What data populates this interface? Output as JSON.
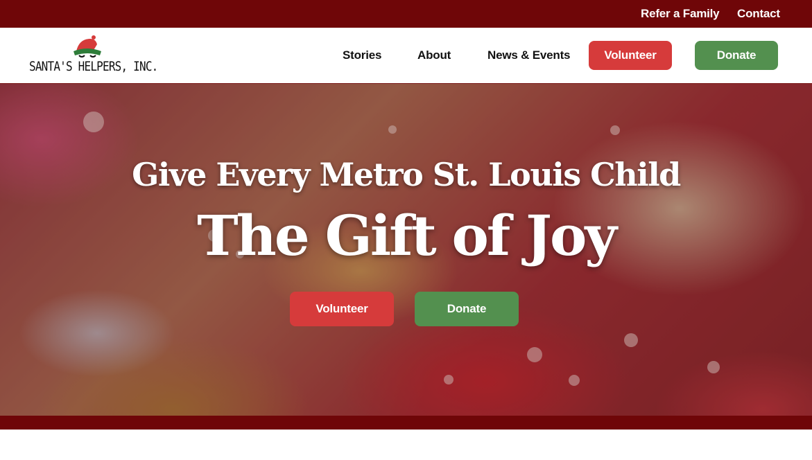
{
  "topbar": {
    "links": [
      "Refer a Family",
      "Contact"
    ]
  },
  "header": {
    "logo_text": "SANTA'S HELPERS, INC.",
    "nav": [
      "Stories",
      "About",
      "News & Events"
    ],
    "volunteer_label": "Volunteer",
    "donate_label": "Donate"
  },
  "hero": {
    "line1": "Give Every Metro St. Louis Child",
    "line2": "The Gift of Joy",
    "volunteer_label": "Volunteer",
    "donate_label": "Donate"
  },
  "colors": {
    "dark_red": "#6f0608",
    "button_red": "#d63b3b",
    "button_green": "#53904f"
  },
  "icons": {
    "logo": "elf-hat-icon"
  }
}
